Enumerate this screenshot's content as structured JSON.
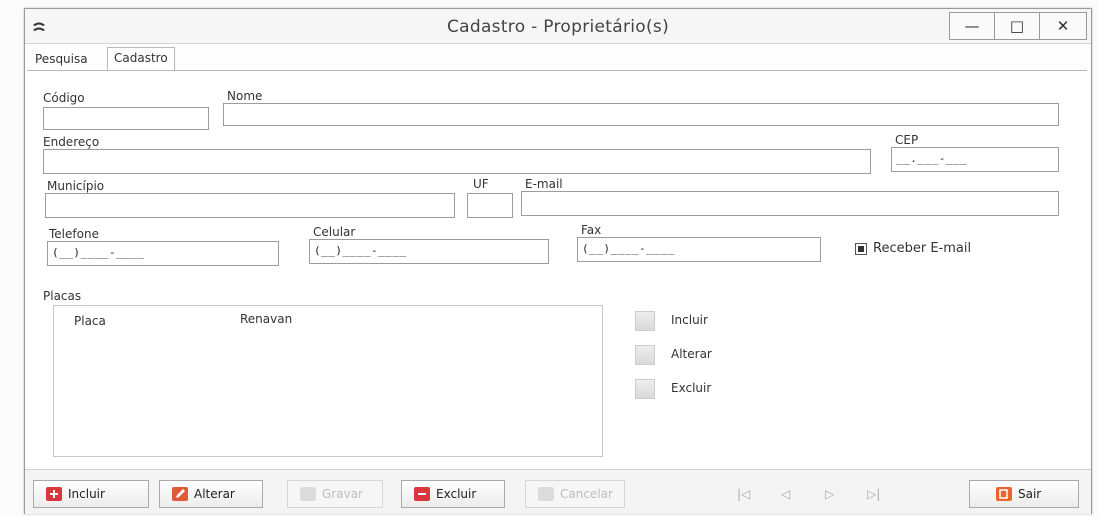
{
  "window": {
    "title": "Cadastro - Proprietário(s)"
  },
  "window_controls": {
    "minimize": "—",
    "maximize": "□",
    "close": "✕"
  },
  "tabs": [
    {
      "label": "Pesquisa"
    },
    {
      "label": "Cadastro"
    }
  ],
  "form": {
    "codigo": {
      "label": "Código",
      "value": ""
    },
    "nome": {
      "label": "Nome",
      "value": ""
    },
    "endereco": {
      "label": "Endereço",
      "value": ""
    },
    "cep": {
      "label": "CEP",
      "mask": "__.___-___"
    },
    "municipio": {
      "label": "Município",
      "value": ""
    },
    "uf": {
      "label": "UF",
      "value": ""
    },
    "email": {
      "label": "E-mail",
      "value": ""
    },
    "telefone": {
      "label": "Telefone",
      "mask": "(__)____-____"
    },
    "celular": {
      "label": "Celular",
      "mask": "(__)____-____"
    },
    "fax": {
      "label": "Fax",
      "mask": "(__)____-____"
    },
    "receber_email": {
      "label": "Receber E-mail",
      "checked": true
    }
  },
  "placas": {
    "label": "Placas",
    "columns": [
      "Placa",
      "Renavan"
    ],
    "buttons": {
      "incluir": "Incluir",
      "alterar": "Alterar",
      "excluir": "Excluir"
    }
  },
  "toolbar": {
    "incluir": "Incluir",
    "alterar": "Alterar",
    "gravar": "Gravar",
    "excluir": "Excluir",
    "cancelar": "Cancelar",
    "sair": "Sair",
    "nav_first": "|◁",
    "nav_prev": "◁",
    "nav_next": "▷",
    "nav_last": "▷|"
  },
  "colors": {
    "red_icon": "#d9363e",
    "orange_icon": "#e8662e",
    "disabled_text": "#bdbdbd"
  }
}
